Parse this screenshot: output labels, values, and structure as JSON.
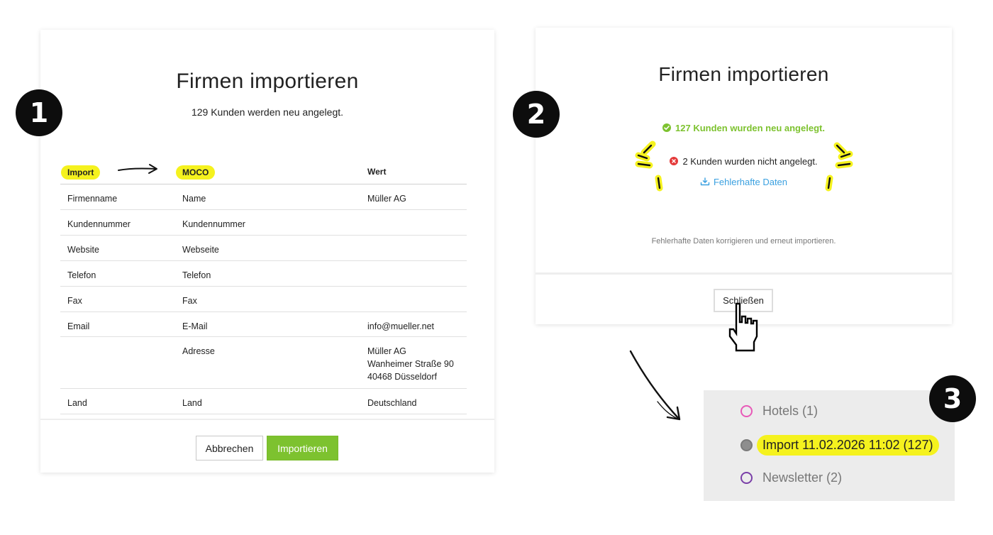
{
  "badges": {
    "step1": "1",
    "step2": "2",
    "step3": "3"
  },
  "import_dialog": {
    "title": "Firmen importieren",
    "subtitle": "129 Kunden werden neu angelegt.",
    "columns": {
      "import": "Import",
      "moco": "MOCO",
      "value": "Wert"
    },
    "rows": [
      {
        "import": "Firmenname",
        "moco": "Name",
        "value": "Müller AG"
      },
      {
        "import": "Kundennummer",
        "moco": "Kundennummer",
        "value": ""
      },
      {
        "import": "Website",
        "moco": "Webseite",
        "value": ""
      },
      {
        "import": "Telefon",
        "moco": "Telefon",
        "value": ""
      },
      {
        "import": "Fax",
        "moco": "Fax",
        "value": ""
      },
      {
        "import": "Email",
        "moco": "E-Mail",
        "value": "info@mueller.net"
      },
      {
        "import": "",
        "moco": "Adresse",
        "value": "Müller AG\nWanheimer Straße 90\n40468 Düsseldorf"
      },
      {
        "import": "Land",
        "moco": "Land",
        "value": "Deutschland"
      }
    ],
    "buttons": {
      "cancel": "Abbrechen",
      "import": "Importieren"
    },
    "colors": {
      "primary": "#7dc22f",
      "highlight": "#f5f21e"
    }
  },
  "result_dialog": {
    "title": "Firmen importieren",
    "success_text": "127 Kunden wurden neu angelegt.",
    "error_text": "2 Kunden wurden nicht angelegt.",
    "error_link": "Fehlerhafte Daten",
    "hint": "Fehlerhafte Daten korrigieren und erneut importieren.",
    "close_button": "Schließen",
    "colors": {
      "success": "#7dc22f",
      "error": "#e43a3a",
      "link": "#3aa0e0"
    }
  },
  "tag_list": {
    "items": [
      {
        "label": "Hotels (1)",
        "dot_color": "#e85ab8",
        "dot_style": "outline"
      },
      {
        "label": "Import 11.02.2026 11:02 (127)",
        "dot_color": "#8e8e8e",
        "dot_style": "filled"
      },
      {
        "label": "Newsletter (2)",
        "dot_color": "#7a3fa8",
        "dot_style": "outline"
      }
    ]
  }
}
